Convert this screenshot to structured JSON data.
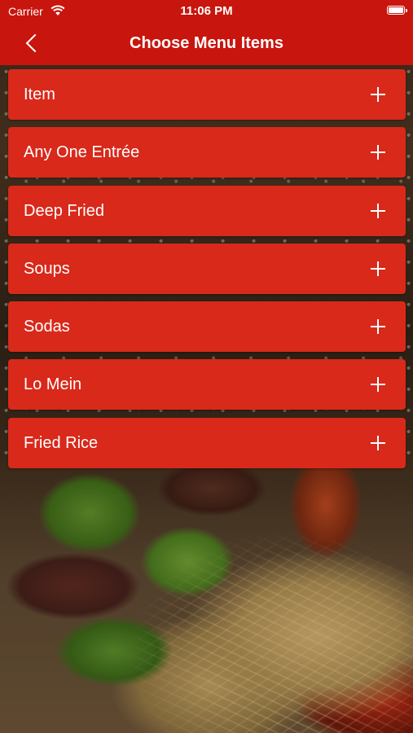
{
  "status_bar": {
    "carrier": "Carrier",
    "time": "11:06 PM"
  },
  "nav": {
    "title": "Choose Menu Items"
  },
  "menu": {
    "items": [
      {
        "label": "Item"
      },
      {
        "label": "Any One Entrée"
      },
      {
        "label": "Deep Fried"
      },
      {
        "label": "Soups"
      },
      {
        "label": "Sodas"
      },
      {
        "label": "Lo Mein"
      },
      {
        "label": "Fried Rice"
      }
    ]
  },
  "colors": {
    "header": "#c8150d",
    "item": "#d8291b",
    "text": "#ffffff"
  },
  "icons": {
    "back": "chevron-left-icon",
    "expand": "plus-icon",
    "wifi": "wifi-icon",
    "battery": "battery-icon"
  }
}
